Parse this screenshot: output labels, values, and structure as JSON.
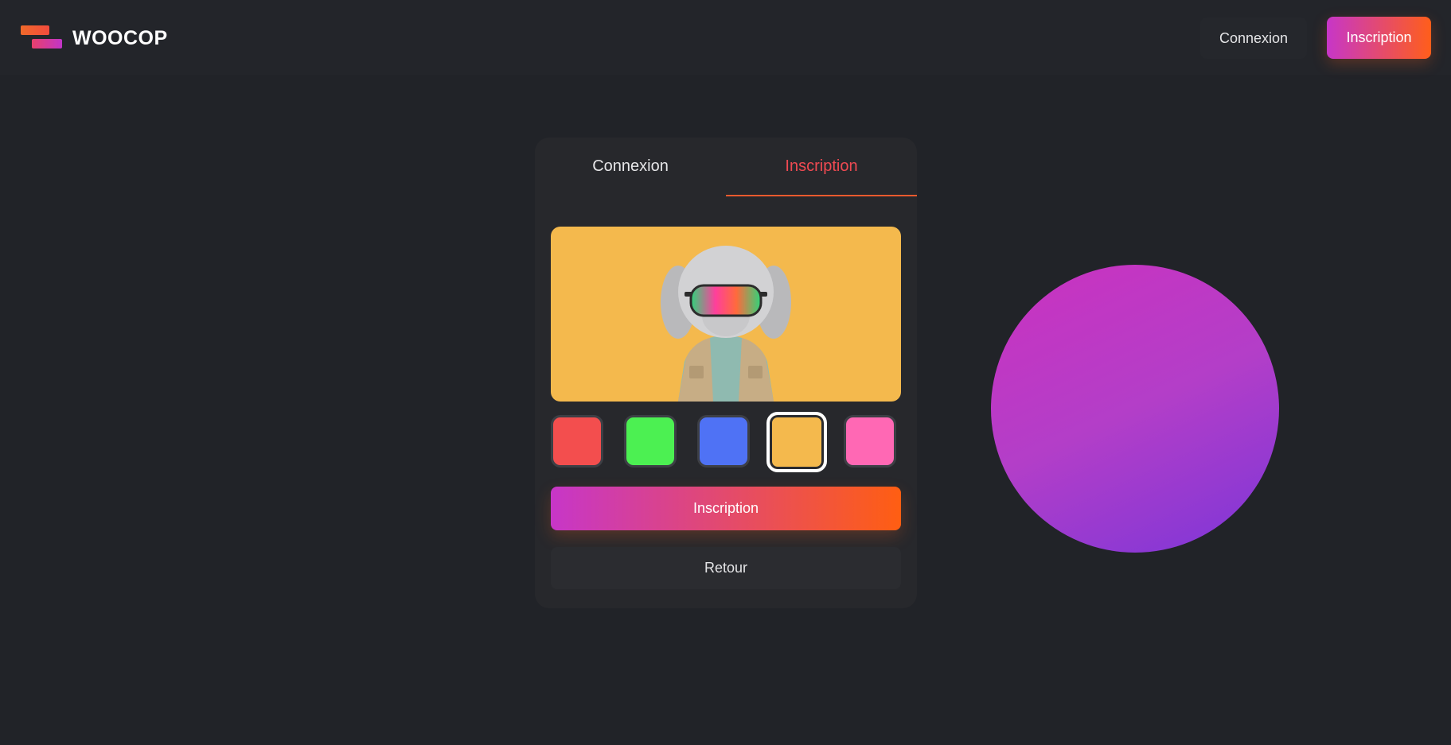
{
  "header": {
    "brand": "WOOCOP",
    "login_label": "Connexion",
    "signup_label": "Inscription"
  },
  "card": {
    "tabs": [
      {
        "label": "Connexion",
        "active": false
      },
      {
        "label": "Inscription",
        "active": true
      }
    ],
    "avatar": {
      "icon": "dog-mascot-icon",
      "background": "#f4b94d"
    },
    "swatches": [
      {
        "color": "#f34e4e",
        "selected": false
      },
      {
        "color": "#4cf052",
        "selected": false
      },
      {
        "color": "#4f72f5",
        "selected": false
      },
      {
        "color": "#f4b94d",
        "selected": true
      },
      {
        "color": "#ff68b4",
        "selected": false
      }
    ],
    "primary_label": "Inscription",
    "back_label": "Retour"
  },
  "colors": {
    "accent_start": "#c736c8",
    "accent_end": "#ff5e1a",
    "active_tab": "#ef4a52"
  }
}
